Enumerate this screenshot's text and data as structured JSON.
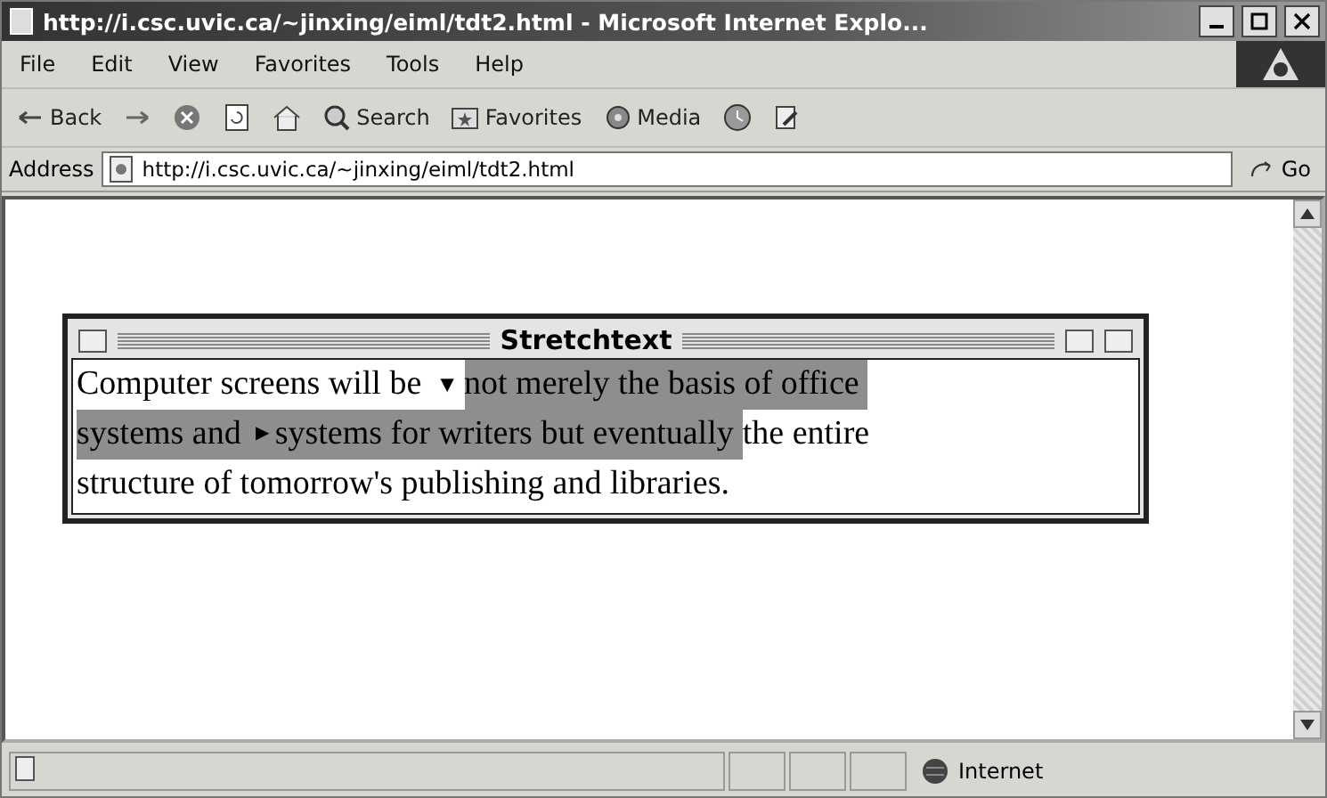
{
  "window": {
    "title": "http://i.csc.uvic.ca/~jinxing/eiml/tdt2.html - Microsoft Internet Explo..."
  },
  "menu": [
    "File",
    "Edit",
    "View",
    "Favorites",
    "Tools",
    "Help"
  ],
  "toolbar": [
    {
      "kind": "back",
      "label": "Back"
    },
    {
      "kind": "forward"
    },
    {
      "kind": "stop"
    },
    {
      "kind": "refresh"
    },
    {
      "kind": "home"
    },
    {
      "kind": "search",
      "label": "Search"
    },
    {
      "kind": "favorites",
      "label": "Favorites"
    },
    {
      "kind": "media",
      "label": "Media"
    },
    {
      "kind": "history"
    },
    {
      "kind": "edit"
    }
  ],
  "address": {
    "label": "Address",
    "value": "http://i.csc.uvic.ca/~jinxing/eiml/tdt2.html",
    "go": "Go"
  },
  "stretchtext": {
    "title": "Stretchtext",
    "lines": [
      [
        {
          "kind": "text",
          "text": "Computer screens will be",
          "highlighted": false
        },
        {
          "kind": "toggle",
          "glyph": "▼",
          "expanded": true
        },
        {
          "kind": "text",
          "text": "not merely the basis of office",
          "highlighted": true
        }
      ],
      [
        {
          "kind": "text",
          "text": "systems and",
          "highlighted": true
        },
        {
          "kind": "toggle",
          "glyph": "▶",
          "expanded": false
        },
        {
          "kind": "text",
          "text": "systems for writers but eventually",
          "highlighted": true
        },
        {
          "kind": "text",
          "text": "the entire",
          "highlighted": false
        }
      ],
      [
        {
          "kind": "text",
          "text": "structure of tomorrow's publishing and libraries.",
          "highlighted": false
        }
      ]
    ]
  },
  "status_bar": {
    "zone": "Internet"
  }
}
